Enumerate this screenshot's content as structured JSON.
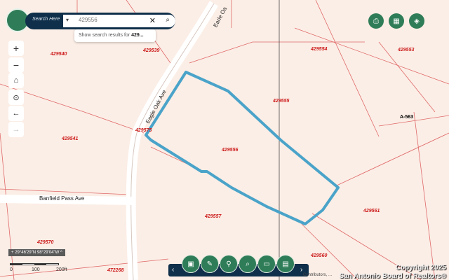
{
  "search": {
    "label": "Search Here",
    "value": "429556",
    "suggestion_prefix": "Show search results for",
    "suggestion_bold": "429..."
  },
  "parcels": [
    {
      "label": "429540"
    },
    {
      "label": "429539"
    },
    {
      "label": "429554"
    },
    {
      "label": "429553"
    },
    {
      "label": "429555"
    },
    {
      "label": "429575"
    },
    {
      "label": "429541"
    },
    {
      "label": "429556"
    },
    {
      "label": "429561"
    },
    {
      "label": "429557"
    },
    {
      "label": "429570"
    },
    {
      "label": "429560"
    },
    {
      "label": "472268"
    },
    {
      "label": "A-563"
    }
  ],
  "roads": {
    "earle_oak": "Earle Oa",
    "eagle_oak": "Eagle Oak Ave",
    "banfield": "Banfield Pass Ave"
  },
  "coordinates": "29°46'29\"N 98°29'04\"W",
  "scale": [
    "0",
    "100",
    "200ft"
  ],
  "copyright": [
    "Copyright 2025",
    "San Antonio Board of Realtors®"
  ],
  "attribution": "Contributors, ..."
}
